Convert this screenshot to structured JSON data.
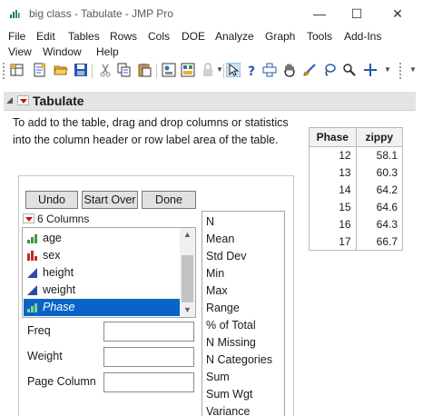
{
  "window": {
    "title": "big class - Tabulate - JMP Pro",
    "minimize_glyph": "—",
    "maximize_glyph": "☐",
    "close_glyph": "✕"
  },
  "menu": {
    "items": [
      "File",
      "Edit",
      "Tables",
      "Rows",
      "Cols",
      "DOE",
      "Analyze",
      "Graph",
      "Tools",
      "Add-Ins",
      "View",
      "Window",
      "Help"
    ]
  },
  "toolbar": {
    "icons": [
      "new-data-table-icon",
      "new-script-icon",
      "open-icon",
      "save-icon",
      "cut-icon",
      "copy-icon",
      "paste-icon",
      "journal-icon",
      "layout-icon",
      "lock-icon",
      "arrow-pointer-icon",
      "help-pointer-icon",
      "selection-crosshair-icon",
      "hand-icon",
      "brush-icon",
      "lasso-icon",
      "zoom-icon",
      "crosshair-icon"
    ]
  },
  "report": {
    "title": "Tabulate",
    "instructions": "To add to the table, drag and drop columns or statistics into the column header or row label area of the table."
  },
  "result_table": {
    "headers": [
      "Phase",
      "zippy"
    ],
    "rows": [
      [
        "12",
        "58.1"
      ],
      [
        "13",
        "60.3"
      ],
      [
        "14",
        "64.2"
      ],
      [
        "15",
        "64.6"
      ],
      [
        "16",
        "64.3"
      ],
      [
        "17",
        "66.7"
      ]
    ]
  },
  "dialog": {
    "undo_label": "Undo",
    "start_over_label": "Start Over",
    "done_label": "Done",
    "columns_label": "6 Columns",
    "columns": [
      {
        "name": "age",
        "type": "ordinal-icon"
      },
      {
        "name": "sex",
        "type": "nominal-icon"
      },
      {
        "name": "height",
        "type": "continuous-icon"
      },
      {
        "name": "weight",
        "type": "continuous-icon"
      },
      {
        "name": "Phase",
        "type": "ordinal-icon",
        "selected": true
      }
    ],
    "freq_label": "Freq",
    "weight_label": "Weight",
    "page_column_label": "Page Column",
    "statistics": [
      "N",
      "Mean",
      "Std Dev",
      "Min",
      "Max",
      "Range",
      "% of Total",
      "N Missing",
      "N Categories",
      "Sum",
      "Sum Wgt",
      "Variance"
    ]
  },
  "colors": {
    "selection": "#0a64c8",
    "red_triangle": "#cc1111",
    "ordinal_green": "#3a9a3a",
    "nominal_red": "#c0282a",
    "continuous_blue": "#2c4aa8"
  }
}
